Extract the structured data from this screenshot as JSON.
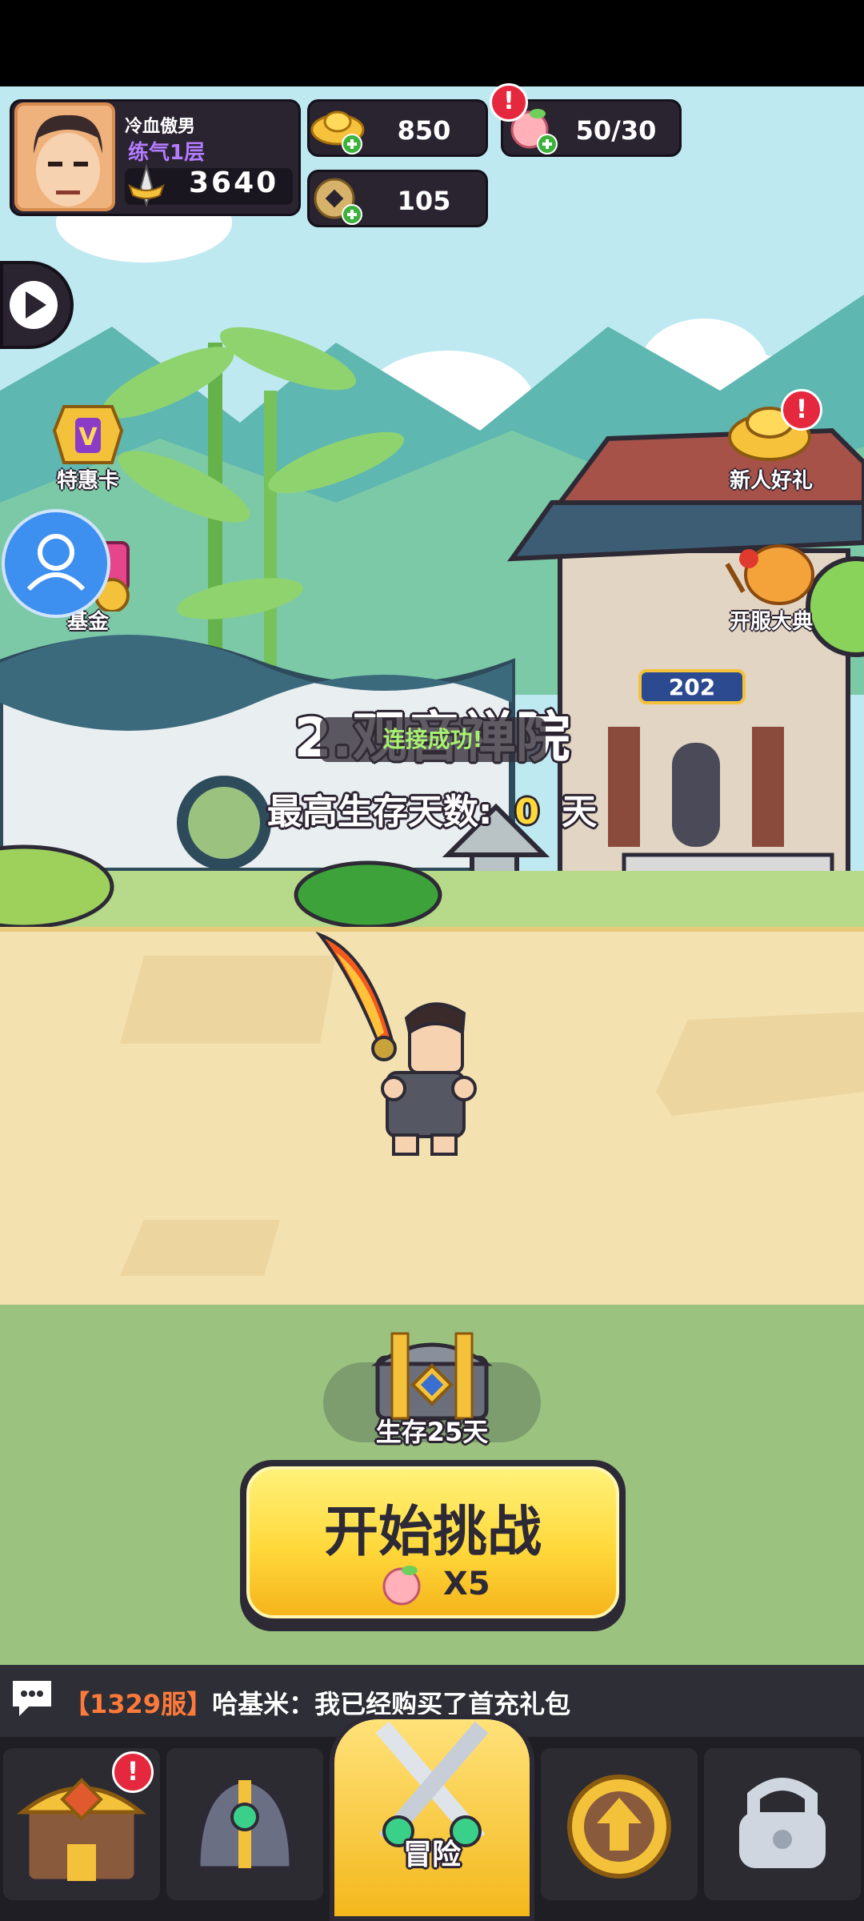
{
  "player": {
    "name": "冷血傲男",
    "realm": "练气1层",
    "power": "3640"
  },
  "resources": {
    "gold": "850",
    "stamina": "50/30",
    "coins": "105",
    "stamina_badge": "!"
  },
  "side_menu": {
    "left": [
      {
        "label": "特惠卡"
      },
      {
        "label": "基金"
      }
    ],
    "right": [
      {
        "label": "新人好礼",
        "badge": "!"
      },
      {
        "label": "开服大典"
      }
    ]
  },
  "stage": {
    "title": "2.观音禅院",
    "toast": "连接成功!",
    "best_prefix": "最高生存天数:",
    "best_days": "0",
    "best_unit": "天",
    "temple_plaque": "202"
  },
  "chest": {
    "label": "生存25天"
  },
  "start_button": {
    "label": "开始挑战",
    "cost": "X5"
  },
  "chat": {
    "server": "【1329服】",
    "text": "哈基米：我已经购买了首充礼包"
  },
  "bottom_nav": {
    "active_label": "冒险",
    "shop_badge": "!"
  },
  "colors": {
    "sky": "#bfe9f1",
    "dirt": "#f4e1b0",
    "grass": "#9cc27f",
    "button_yellow": "#ffd83a",
    "realm_purple": "#b37cff",
    "badge_red": "#e6283e"
  }
}
